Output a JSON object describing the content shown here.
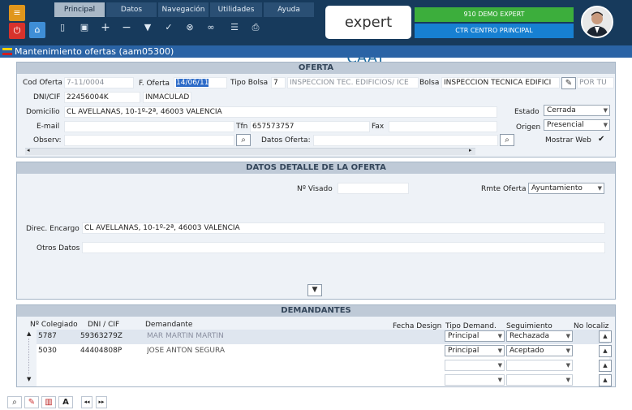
{
  "menu": {
    "tabs": [
      "Principal",
      "Datos",
      "Navegación",
      "Utilidades",
      "Ayuda"
    ]
  },
  "brand": {
    "part1": "expert",
    "part2": "CAAT",
    "reg": "®"
  },
  "user": {
    "name": "910 DEMO EXPERT",
    "center": "CTR CENTRO PRINCIPAL"
  },
  "window": {
    "title": "Mantenimiento ofertas (aam05300)"
  },
  "oferta": {
    "header": "OFERTA",
    "cod_label": "Cod Oferta",
    "cod_value": "7-11/0004",
    "fecha_label": "F. Oferta",
    "fecha_value": "14/06/11",
    "tipo_label": "Tipo Bolsa",
    "tipo_value": "7",
    "tipo_desc": "INSPECCION TEC. EDIFICIOS/ ICE",
    "bolsa_label": "Bolsa",
    "bolsa_value": "INSPECCION TECNICA EDIFICI",
    "bolsa_extra": "POR TU",
    "dni_label": "DNI/CIF",
    "dni_value": "22456004K",
    "dni_name": "INMACULAD",
    "domicilio_label": "Domicilio",
    "domicilio_value": "CL AVELLANAS, 10-1º-2ª, 46003 VALENCIA",
    "estado_label": "Estado",
    "estado_value": "Cerrada",
    "email_label": "E-mail",
    "tfn_label": "Tfn",
    "tfn_value": "657573757",
    "fax_label": "Fax",
    "origen_label": "Origen",
    "origen_value": "Presencial",
    "observ_label": "Observ:",
    "datos_label": "Datos Oferta:",
    "web_label": "Mostrar Web"
  },
  "detalle": {
    "header": "DATOS DETALLE DE LA OFERTA",
    "visado_label": "Nº Visado",
    "rmte_label": "Rmte Oferta",
    "rmte_value": "Ayuntamiento",
    "direc_label": "Direc. Encargo",
    "direc_value": "CL AVELLANAS, 10-1º-2ª, 46003 VALENCIA",
    "otros_label": "Otros Datos"
  },
  "demandantes": {
    "header": "DEMANDANTES",
    "columns": [
      "Nº Colegiado",
      "DNI / CIF",
      "Demandante",
      "Fecha Design",
      "Tipo Demand.",
      "Seguimiento",
      "No localiz"
    ],
    "rows": [
      {
        "colegiado": "5787",
        "dni": "59363279Z",
        "nombre": "MAR MARTIN MARTIN",
        "tipo": "Principal",
        "seguimiento": "Rechazada"
      },
      {
        "colegiado": "5030",
        "dni": "44404808P",
        "nombre": "JOSE ANTON SEGURA",
        "tipo": "Principal",
        "seguimiento": "Aceptado"
      }
    ]
  },
  "colors": {
    "topbar": "#173a5c",
    "title_bar": "#2a63a5",
    "panel_header": "#bfcad7",
    "green": "#3cae3c",
    "blue": "#1780d2"
  }
}
